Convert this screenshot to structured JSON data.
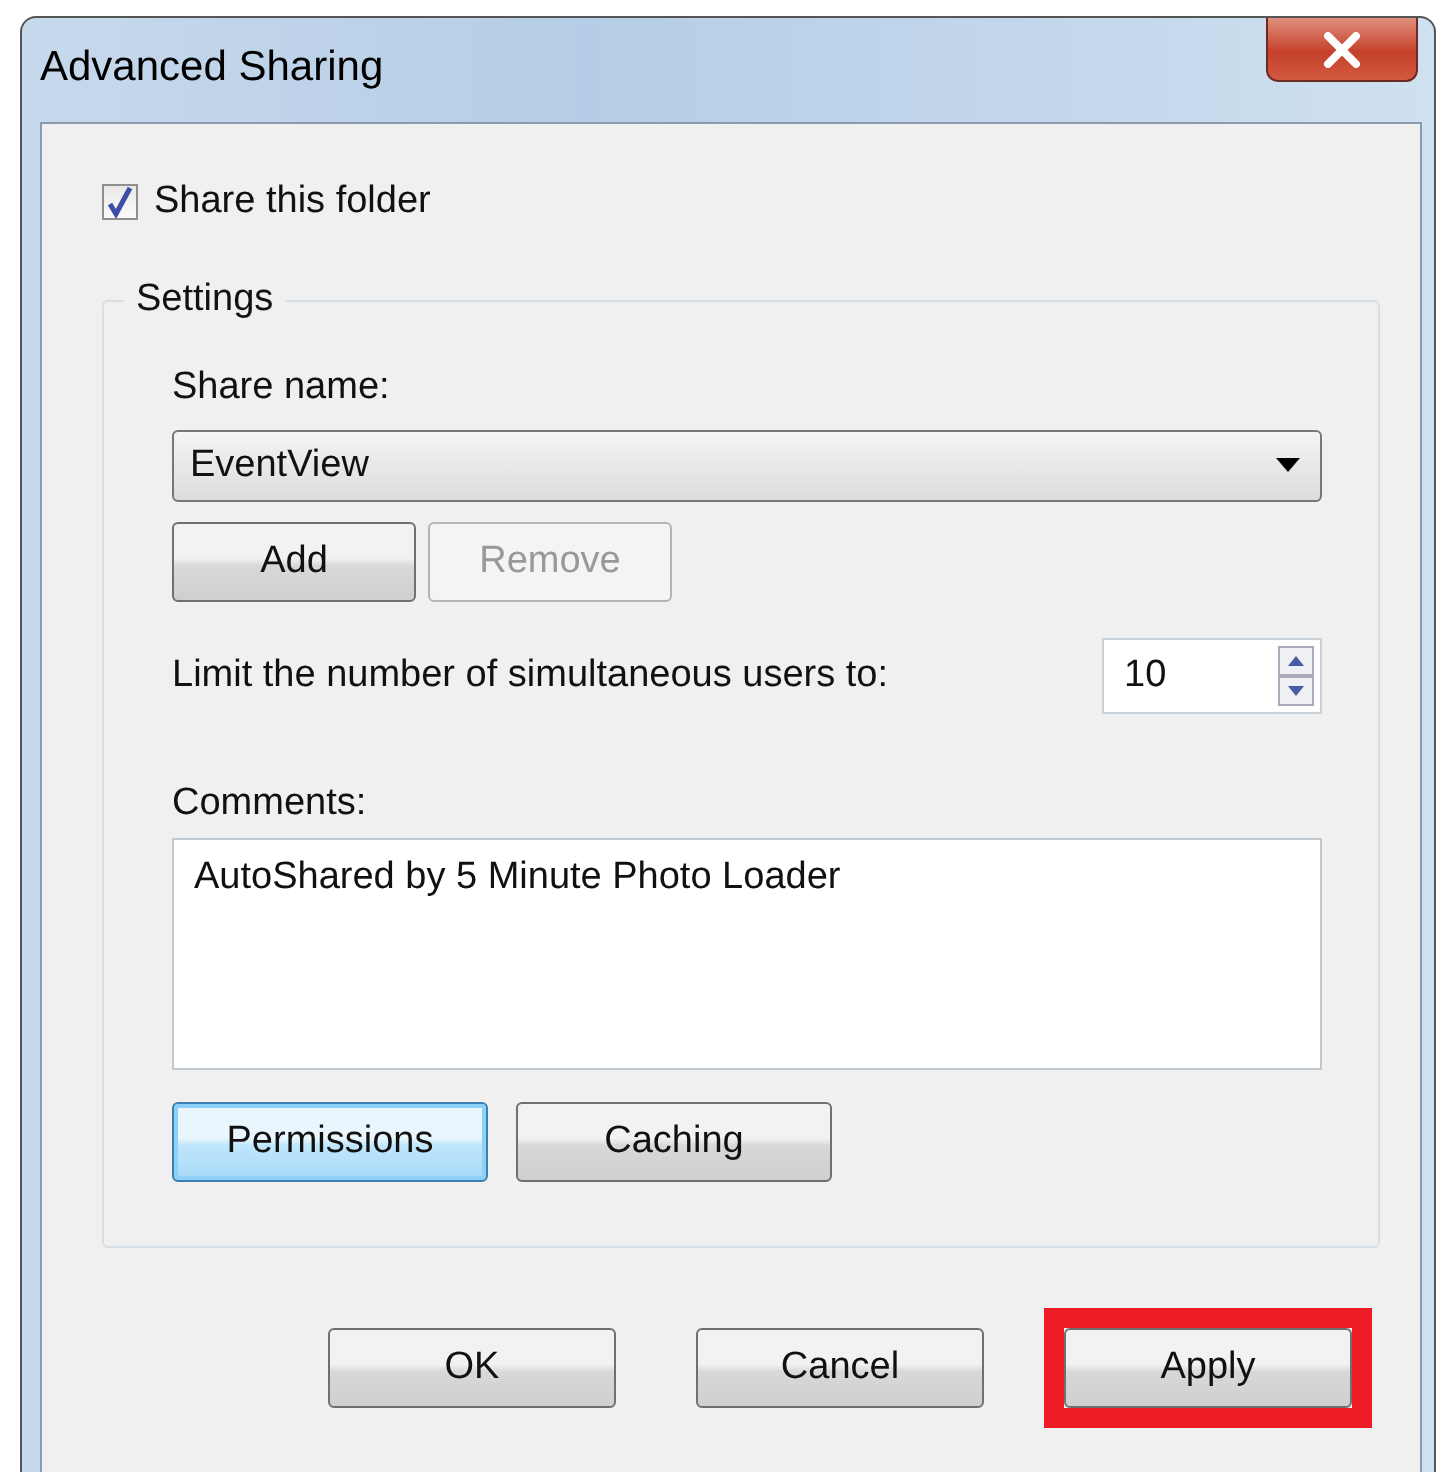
{
  "window": {
    "title": "Advanced Sharing"
  },
  "share_checkbox": {
    "label": "Share this folder",
    "checked": true
  },
  "settings": {
    "title": "Settings",
    "share_name": {
      "label": "Share name:",
      "value": "EventView"
    },
    "name_buttons": [
      {
        "label": "Add",
        "disabled": false
      },
      {
        "label": "Remove",
        "disabled": true
      }
    ],
    "user_limit": {
      "label": "Limit the number of simultaneous users to:",
      "value": "10"
    },
    "comments": {
      "label": "Comments:",
      "value": "AutoShared by 5 Minute Photo Loader"
    },
    "buttons": [
      {
        "label": "Permissions",
        "focused": true
      },
      {
        "label": "Caching",
        "focused": false
      }
    ]
  },
  "footer_buttons": [
    {
      "label": "OK",
      "highlighted": false
    },
    {
      "label": "Cancel",
      "highlighted": false
    },
    {
      "label": "Apply",
      "highlighted": true
    }
  ]
}
